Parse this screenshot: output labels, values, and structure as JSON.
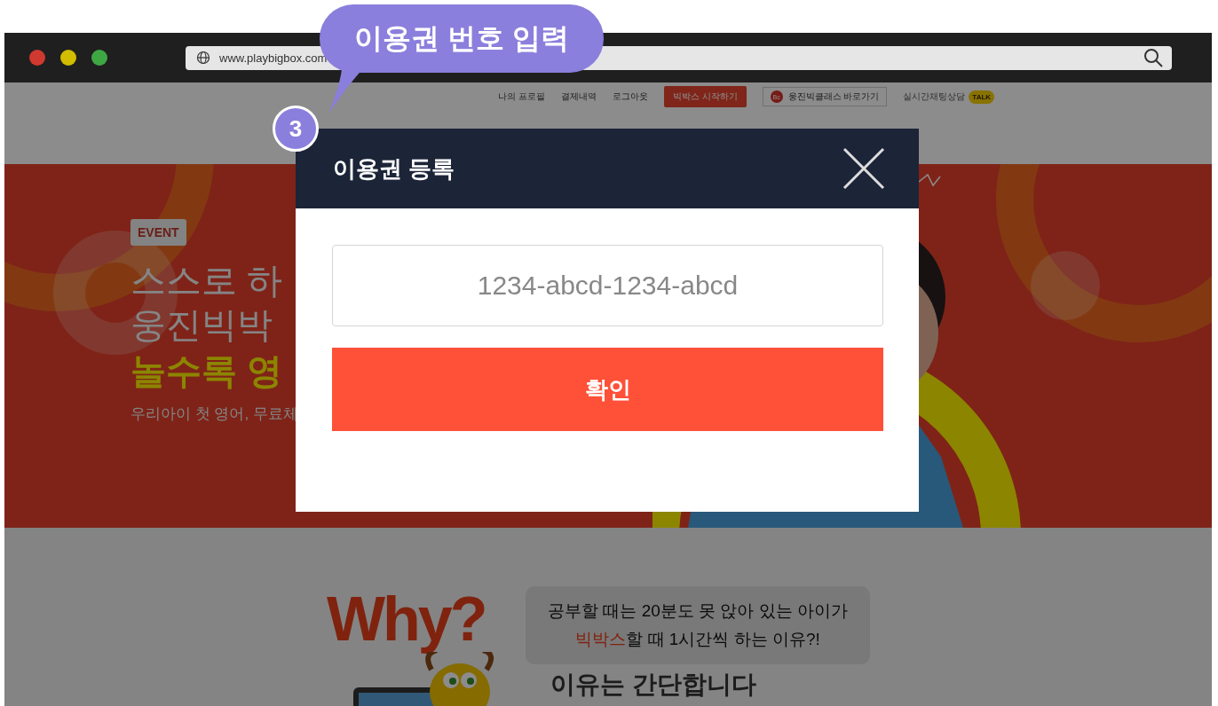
{
  "browser": {
    "url": "www.playbigbox.com"
  },
  "nav": {
    "links": [
      "나의 프로필",
      "결제내역",
      "로그아웃"
    ],
    "start_button": "빅박스 시작하기",
    "class_link": {
      "badge": "Bc",
      "label": "웅진빅클래스 바로가기"
    },
    "chat": {
      "label": "실시간채팅상담",
      "badge": "TALK"
    }
  },
  "banner": {
    "tag": "EVENT",
    "lines": [
      "스스로 하",
      "웅진빅박"
    ],
    "highlight": "놀수록 영",
    "subtitle": "우리아이 첫 영어, 무료체"
  },
  "promo": {
    "heading": "Why?",
    "bubble_line": "공부할 때는 20분도 못 앉아 있는 아이가",
    "bubble_accent": "빅박스",
    "bubble_rest": "할 때 1시간씩 하는 이유?!",
    "answer": "이유는 간단합니다"
  },
  "modal": {
    "title": "이용권 등록",
    "code_field": {
      "placeholder": "1234-abcd-1234-abcd"
    },
    "confirm_button": "확인"
  },
  "callout": {
    "text": "이용권 번호 입력",
    "step": "3"
  }
}
